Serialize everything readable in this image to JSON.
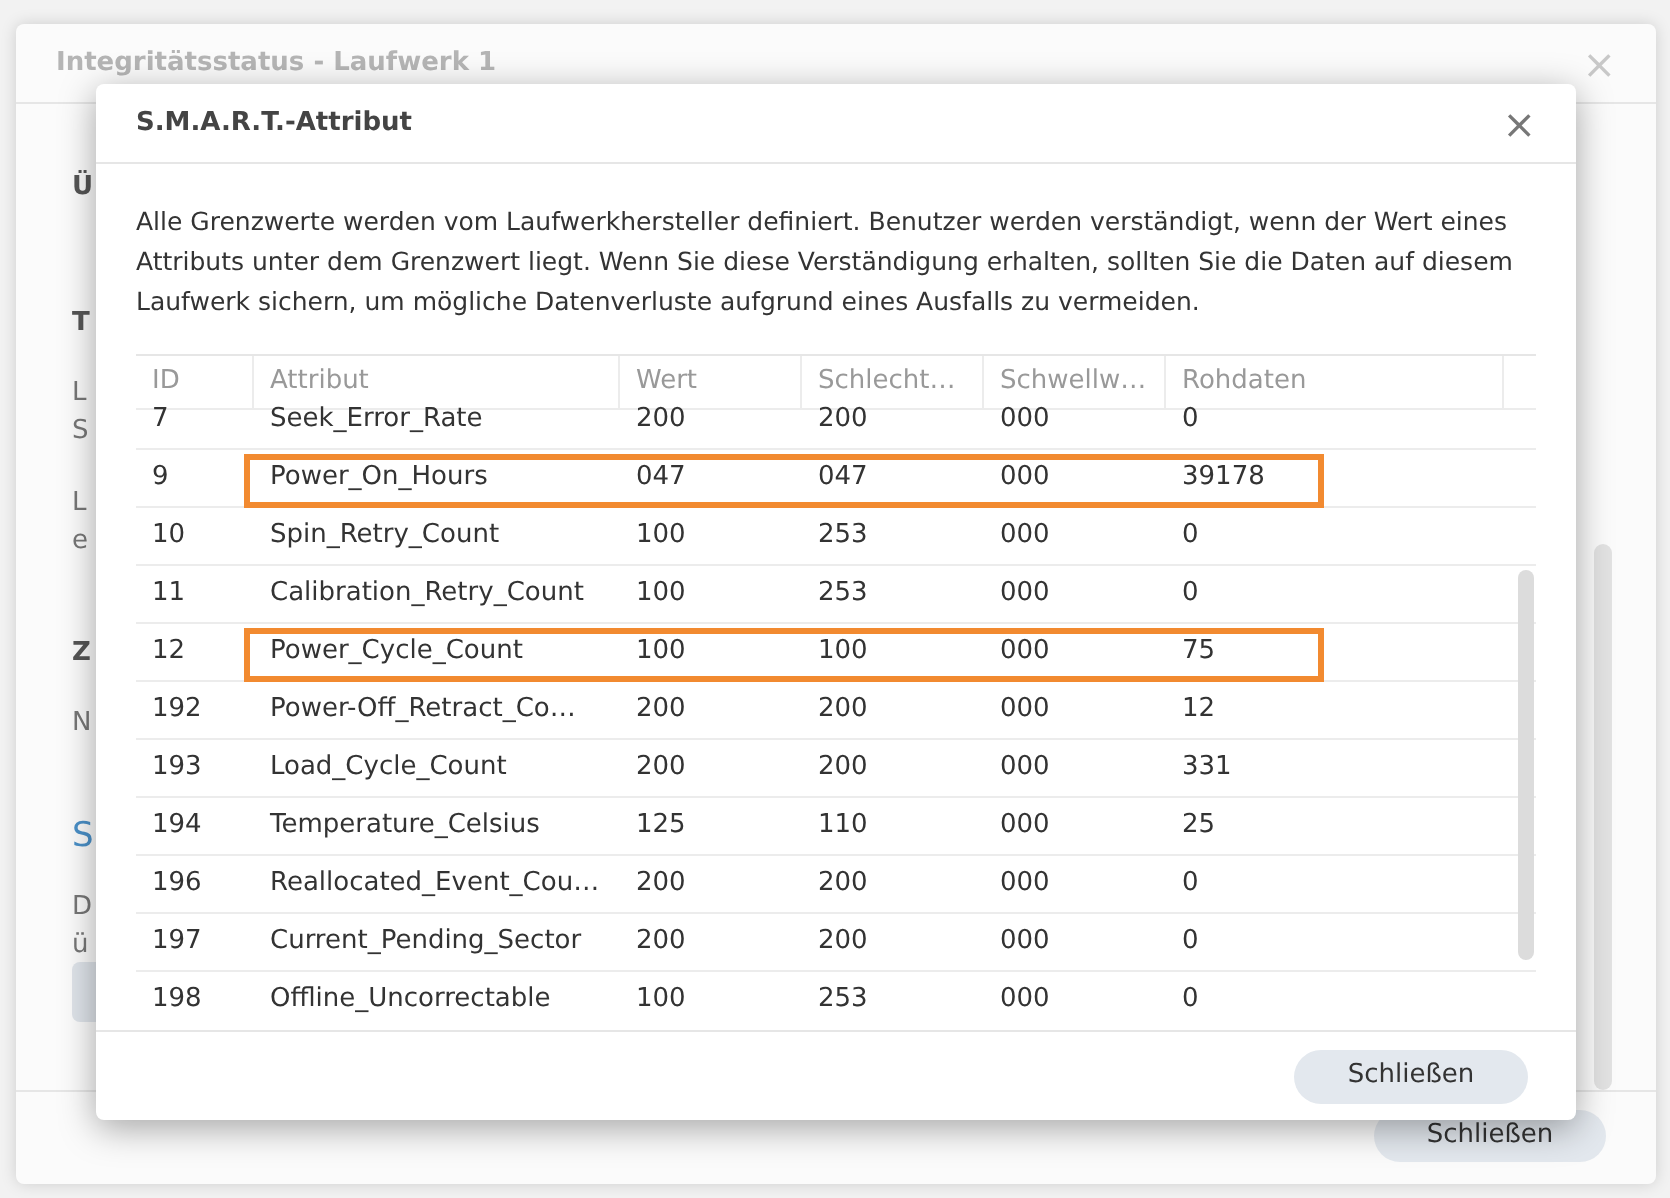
{
  "background_window": {
    "title": "Integritätsstatus - Laufwerk 1",
    "close": "×",
    "fragments": [
      {
        "text": "Ü",
        "kind": "heading"
      },
      {
        "text": "T",
        "kind": "heading"
      },
      {
        "text": "L",
        "kind": "text"
      },
      {
        "text": "S",
        "kind": "text"
      },
      {
        "text": "L",
        "kind": "text"
      },
      {
        "text": "e",
        "kind": "text"
      },
      {
        "text": "Z",
        "kind": "heading"
      },
      {
        "text": "N",
        "kind": "text"
      },
      {
        "text": "S",
        "kind": "link"
      },
      {
        "text": "D",
        "kind": "text"
      },
      {
        "text": "ü",
        "kind": "text"
      }
    ],
    "button": "Schließen"
  },
  "dialog": {
    "title": "S.M.A.R.T.-Attribut",
    "close": "×",
    "description": "Alle Grenzwerte werden vom Laufwerkhersteller definiert. Benutzer werden verständigt, wenn der Wert eines Attributs unter dem Grenzwert liegt. Wenn Sie diese Verständigung erhalten, sollten Sie die Daten auf diesem Laufwerk sichern, um mögliche Datenverluste aufgrund eines Ausfalls zu vermeiden.",
    "table": {
      "columns": [
        "ID",
        "Attribut",
        "Wert",
        "Schlecht…",
        "Schwellw…",
        "Rohdaten"
      ],
      "rows": [
        {
          "cells": [
            "7",
            "Seek_Error_Rate",
            "200",
            "200",
            "000",
            "0"
          ],
          "highlighted": false
        },
        {
          "cells": [
            "9",
            "Power_On_Hours",
            "047",
            "047",
            "000",
            "39178"
          ],
          "highlighted": true
        },
        {
          "cells": [
            "10",
            "Spin_Retry_Count",
            "100",
            "253",
            "000",
            "0"
          ],
          "highlighted": false
        },
        {
          "cells": [
            "11",
            "Calibration_Retry_Count",
            "100",
            "253",
            "000",
            "0"
          ],
          "highlighted": false
        },
        {
          "cells": [
            "12",
            "Power_Cycle_Count",
            "100",
            "100",
            "000",
            "75"
          ],
          "highlighted": true
        },
        {
          "cells": [
            "192",
            "Power-Off_Retract_Co…",
            "200",
            "200",
            "000",
            "12"
          ],
          "highlighted": false
        },
        {
          "cells": [
            "193",
            "Load_Cycle_Count",
            "200",
            "200",
            "000",
            "331"
          ],
          "highlighted": false
        },
        {
          "cells": [
            "194",
            "Temperature_Celsius",
            "125",
            "110",
            "000",
            "25"
          ],
          "highlighted": false
        },
        {
          "cells": [
            "196",
            "Reallocated_Event_Cou…",
            "200",
            "200",
            "000",
            "0"
          ],
          "highlighted": false
        },
        {
          "cells": [
            "197",
            "Current_Pending_Sector",
            "200",
            "200",
            "000",
            "0"
          ],
          "highlighted": false
        },
        {
          "cells": [
            "198",
            "Offline_Uncorrectable",
            "100",
            "253",
            "000",
            "0"
          ],
          "highlighted": false
        }
      ]
    },
    "button": "Schließen"
  }
}
